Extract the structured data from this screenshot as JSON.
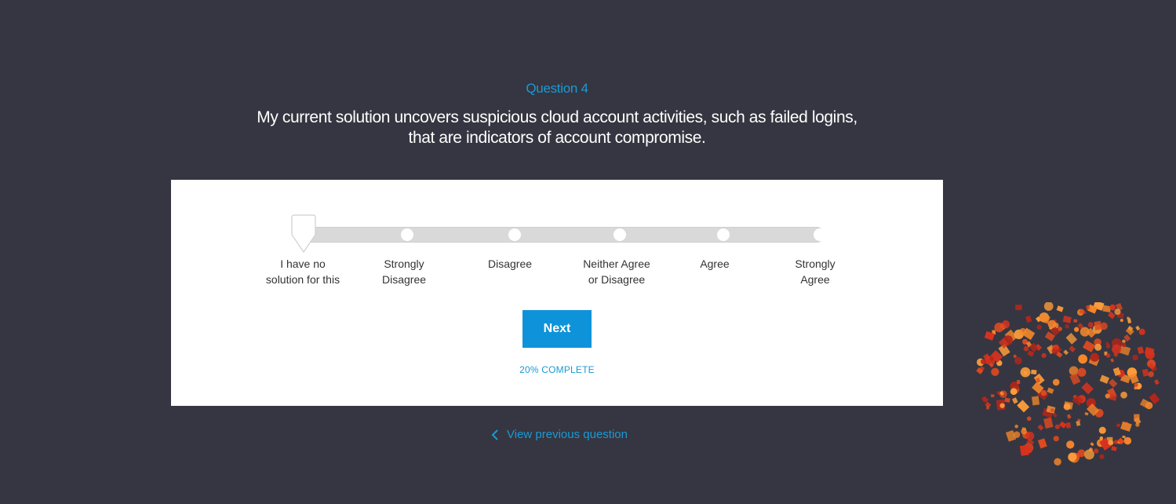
{
  "question": {
    "number_label": "Question 4",
    "text": "My current solution uncovers suspicious cloud account activities, such as failed logins, that are indicators of account compromise."
  },
  "scale": {
    "selected_index": 0,
    "options": [
      {
        "line1": "I have no",
        "line2": "solution for this"
      },
      {
        "line1": "Strongly",
        "line2": "Disagree"
      },
      {
        "line1": "Disagree",
        "line2": ""
      },
      {
        "line1": "Neither Agree",
        "line2": "or Disagree"
      },
      {
        "line1": "Agree",
        "line2": ""
      },
      {
        "line1": "Strongly",
        "line2": "Agree"
      }
    ]
  },
  "actions": {
    "next_label": "Next",
    "progress_label": "20% COMPLETE",
    "progress_percent": 20,
    "previous_label": "View previous question"
  },
  "icons": {
    "previous": "chevron-left-icon",
    "slider_handle": "slider-handle-icon",
    "decoration": "decorative-icon-cluster"
  },
  "colors": {
    "background": "#353641",
    "accent": "#1a9ad6",
    "button": "#0e93da",
    "card": "#ffffff",
    "track": "#d9d9d9",
    "decor_red": "#d8321e",
    "decor_orange": "#f5862a"
  }
}
